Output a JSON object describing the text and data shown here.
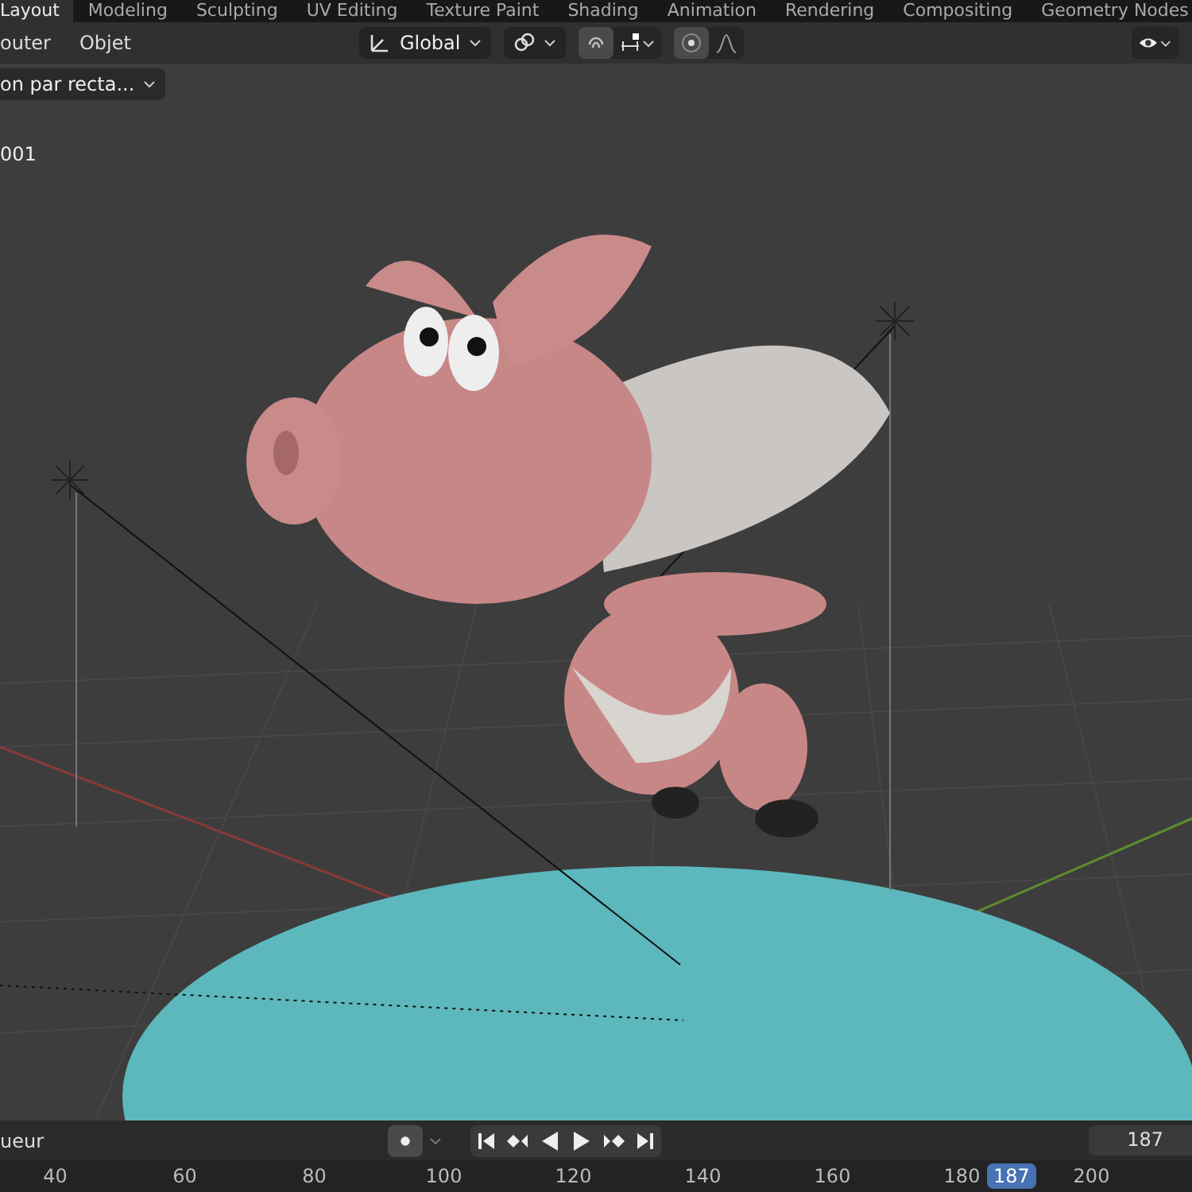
{
  "workspace_tabs": [
    {
      "label": "Layout",
      "selected": true
    },
    {
      "label": "Modeling",
      "selected": false
    },
    {
      "label": "Sculpting",
      "selected": false
    },
    {
      "label": "UV Editing",
      "selected": false
    },
    {
      "label": "Texture Paint",
      "selected": false
    },
    {
      "label": "Shading",
      "selected": false
    },
    {
      "label": "Animation",
      "selected": false
    },
    {
      "label": "Rendering",
      "selected": false
    },
    {
      "label": "Compositing",
      "selected": false
    },
    {
      "label": "Geometry Nodes",
      "selected": false
    }
  ],
  "header": {
    "menus": [
      "outer",
      "Objet"
    ],
    "orientation": "Global",
    "snap_on": true,
    "proportional_on": true
  },
  "tool_settings": {
    "selection_mode": "on par recta..."
  },
  "viewport": {
    "object_label": "001"
  },
  "playback": {
    "label": "ueur",
    "current_frame": "187"
  },
  "timeline": {
    "ticks": [
      "40",
      "60",
      "80",
      "100",
      "120",
      "140",
      "160",
      "180",
      "200"
    ],
    "current_frame": "187"
  }
}
